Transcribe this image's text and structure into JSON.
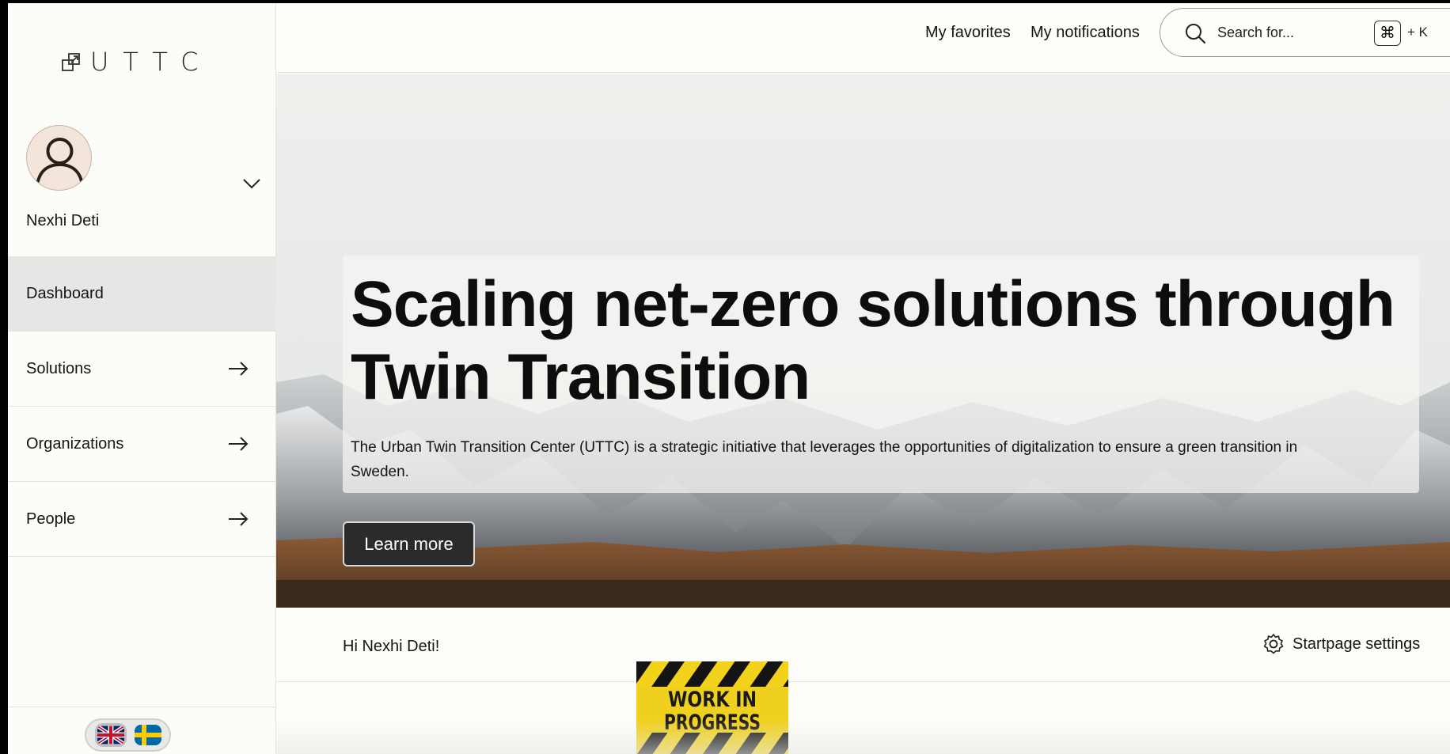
{
  "app": {
    "logo_text": "UTTC"
  },
  "user": {
    "name": "Nexhi Deti"
  },
  "nav": {
    "items": [
      {
        "label": "Dashboard",
        "active": true
      },
      {
        "label": "Solutions"
      },
      {
        "label": "Organizations"
      },
      {
        "label": "People"
      }
    ]
  },
  "topbar": {
    "favorites": "My favorites",
    "notifications": "My notifications",
    "search_placeholder": "Search for...",
    "shortcut_key": "⌘",
    "shortcut_plus": "+ K"
  },
  "hero": {
    "title": "Scaling net-zero solutions through Twin Transition",
    "description": "The Urban Twin Transition Center (UTTC) is a strategic initiative that leverages the opportunities of digitalization to ensure a green transition in Sweden.",
    "button": "Learn more"
  },
  "greeting": {
    "text": "Hi Nexhi Deti!",
    "settings_label": "Startpage settings"
  },
  "wip": {
    "text": "WORK IN PROGRESS"
  },
  "languages": [
    "English",
    "Swedish"
  ],
  "colors": {
    "accent_dark": "#2b2b2b",
    "active_nav": "#e6e6e4",
    "background": "#fdfdf9"
  }
}
